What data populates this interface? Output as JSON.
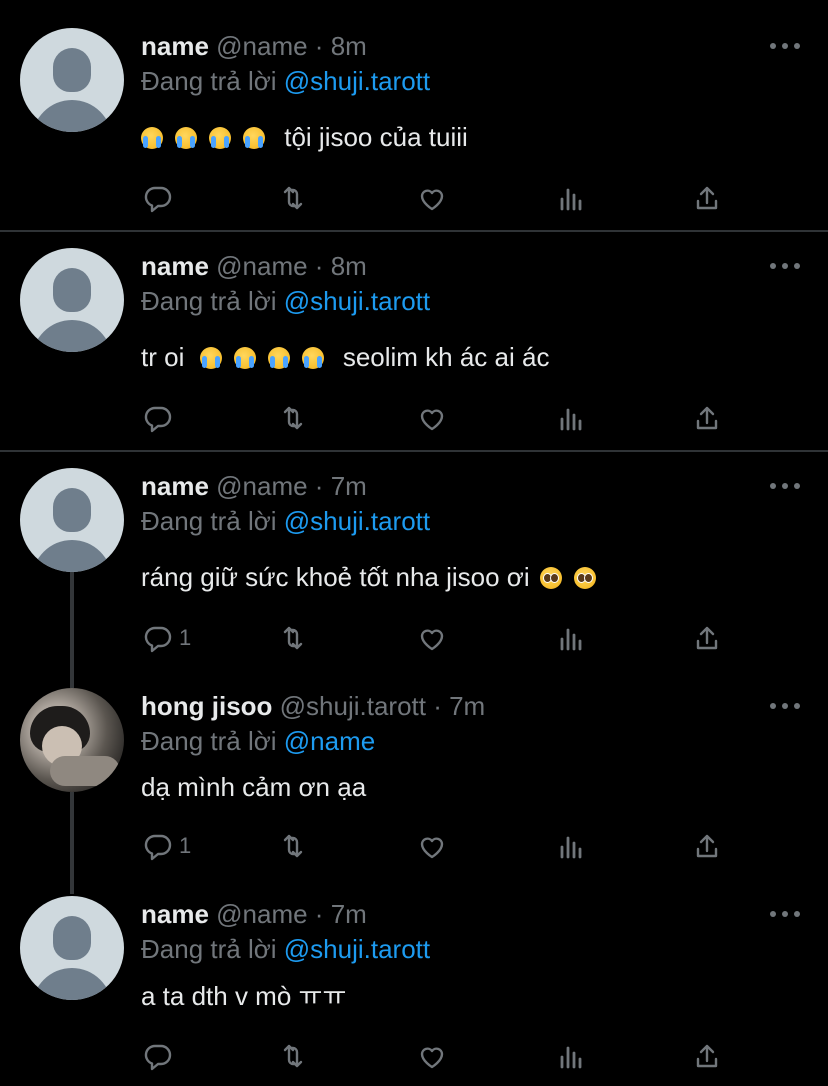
{
  "colors": {
    "background": "#000000",
    "text": "#e7e9ea",
    "muted": "#71767b",
    "link": "#1d9bf0",
    "divider": "#2f3336"
  },
  "icons": [
    "reply-icon",
    "retweet-icon",
    "like-icon",
    "analytics-icon",
    "share-icon",
    "more-icon"
  ],
  "tweets": [
    {
      "name": "name",
      "meta": "@name · 8m",
      "reply_prefix": "Đang trả lời ",
      "reply_handle": "@shuji.tarott",
      "emojis": "😭 😭 😭 😭",
      "text": "tội jisoo của tuiii",
      "reply_count": ""
    },
    {
      "name": "name",
      "meta": "@name · 8m",
      "reply_prefix": "Đang trả lời ",
      "reply_handle": "@shuji.tarott",
      "text_before": "tr oi",
      "emojis": "😭 😭 😭 😭",
      "text": "seolim kh ác ai ác",
      "reply_count": ""
    },
    {
      "name": "name",
      "meta": "@name · 7m",
      "reply_prefix": "Đang trả lời ",
      "reply_handle": "@shuji.tarott",
      "text": "ráng giữ sức khoẻ tốt nha jisoo ơi",
      "emojis": "🥺 🥺",
      "reply_count": "1"
    },
    {
      "name": "hong jisoo",
      "meta": "@shuji.tarott · 7m",
      "reply_prefix": "Đang trả lời ",
      "reply_handle": "@name",
      "text": "dạ mình cảm ơn ạa",
      "reply_count": "1"
    },
    {
      "name": "name",
      "meta": "@name · 7m",
      "reply_prefix": "Đang trả lời ",
      "reply_handle": "@shuji.tarott",
      "text": "a ta dth v mò ㅠㅠ",
      "reply_count": ""
    }
  ]
}
